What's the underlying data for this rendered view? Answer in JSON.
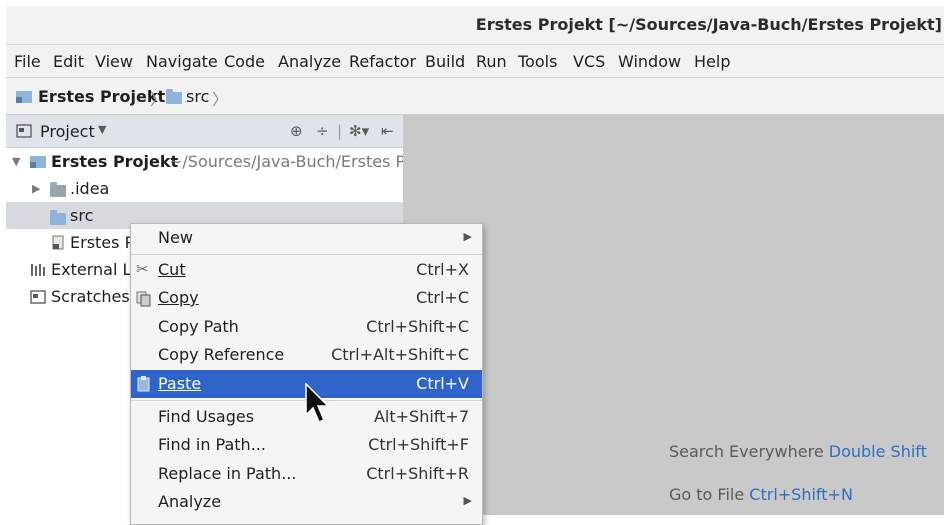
{
  "window": {
    "title": "Erstes Projekt [~/Sources/Java-Buch/Erstes Projekt]"
  },
  "menubar": {
    "items": [
      "File",
      "Edit",
      "View",
      "Navigate",
      "Code",
      "Analyze",
      "Refactor",
      "Build",
      "Run",
      "Tools",
      "VCS",
      "Window",
      "Help"
    ]
  },
  "navbar": {
    "project": "Erstes Projekt",
    "folder": "src"
  },
  "project_panel": {
    "label": "Project",
    "icons": [
      "globe-icon",
      "collapse-all-icon",
      "gear-icon",
      "hide-icon"
    ]
  },
  "tree": {
    "root_name": "Erstes Projekt",
    "root_path": "~/Sources/Java-Buch/Erstes Pro",
    "idea": ".idea",
    "src": "src",
    "erstes_file": "Erstes P",
    "external_libs": "External Lil",
    "scratches": "Scratches a"
  },
  "context_menu": {
    "new": "New",
    "cut": {
      "label": "Cut",
      "shortcut": "Ctrl+X"
    },
    "copy": {
      "label": "Copy",
      "shortcut": "Ctrl+C"
    },
    "copy_path": {
      "label": "Copy Path",
      "shortcut": "Ctrl+Shift+C"
    },
    "copy_reference": {
      "label": "Copy Reference",
      "shortcut": "Ctrl+Alt+Shift+C"
    },
    "paste": {
      "label": "Paste",
      "shortcut": "Ctrl+V"
    },
    "find_usages": {
      "label": "Find Usages",
      "shortcut": "Alt+Shift+7"
    },
    "find_in_path": {
      "label": "Find in Path...",
      "shortcut": "Ctrl+Shift+F"
    },
    "replace_in_path": {
      "label": "Replace in Path...",
      "shortcut": "Ctrl+Shift+R"
    },
    "analyze": "Analyze"
  },
  "editor_hints": {
    "search_label": "Search Everywhere",
    "search_key": "Double Shift",
    "goto_label": "Go to File",
    "goto_key": "Ctrl+Shift+N"
  },
  "colors": {
    "selection": "#2f65ca",
    "accent_link": "#2f6ec0",
    "folder": "#8fb4d9"
  }
}
